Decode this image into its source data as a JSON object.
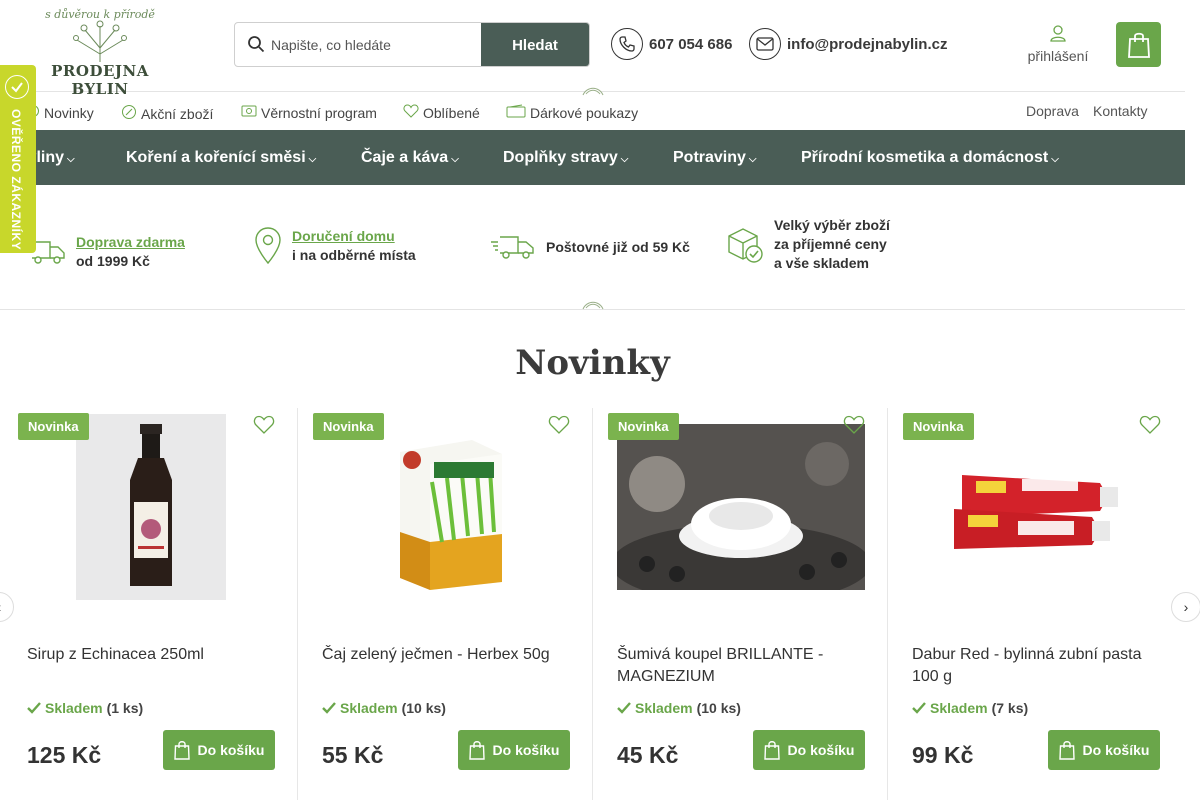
{
  "logo": {
    "tagline": "s důvěrou k přírodě",
    "name": "PRODEJNA BYLIN"
  },
  "search": {
    "placeholder": "Napište, co hledáte",
    "button": "Hledat"
  },
  "contacts": {
    "phone": "607 054 686",
    "email": "info@prodejnabylin.cz"
  },
  "account": {
    "login": "přihlášení"
  },
  "subnav": {
    "items": [
      "Novinky",
      "Akční zboží",
      "Věrnostní program",
      "Oblíbené",
      "Dárkové poukazy"
    ],
    "right": [
      "Doprava",
      "Kontakty"
    ]
  },
  "mainnav": [
    "Byliny",
    "Koření a kořenící směsi",
    "Čaje a káva",
    "Doplňky stravy",
    "Potraviny",
    "Přírodní kosmetika a domácnost"
  ],
  "verified": {
    "label": "OVĚŘENO ZÁKAZNÍKY"
  },
  "benefits": [
    {
      "link": "Doprava zdarma",
      "text": "od 1999 Kč"
    },
    {
      "link": "Doručení domu",
      "text": "i na odběrné místa"
    },
    {
      "text": "Poštovné již od 59 Kč"
    },
    {
      "line1": "Velký výběr zboží",
      "line2": "za příjemné ceny",
      "line3": "a vše skladem"
    }
  ],
  "section": {
    "title": "Novinky"
  },
  "products": [
    {
      "badge": "Novinka",
      "name": "Sirup z Echinacea 250ml",
      "stock": "Skladem",
      "qty": "(1 ks)",
      "price": "125 Kč",
      "cta": "Do košíku"
    },
    {
      "badge": "Novinka",
      "name": "Čaj zelený ječmen - Herbex 50g",
      "stock": "Skladem",
      "qty": "(10 ks)",
      "price": "55 Kč",
      "cta": "Do košíku"
    },
    {
      "badge": "Novinka",
      "name": "Šumivá koupel BRILLANTE - MAGNEZIUM",
      "stock": "Skladem",
      "qty": "(10 ks)",
      "price": "45 Kč",
      "cta": "Do košíku"
    },
    {
      "badge": "Novinka",
      "name": "Dabur Red - bylinná zubní pasta 100 g",
      "stock": "Skladem",
      "qty": "(7 ks)",
      "price": "99 Kč",
      "cta": "Do košíku"
    }
  ],
  "colors": {
    "accent": "#6aa64a",
    "nav": "#4a5d56",
    "badge": "#c8d72b"
  }
}
